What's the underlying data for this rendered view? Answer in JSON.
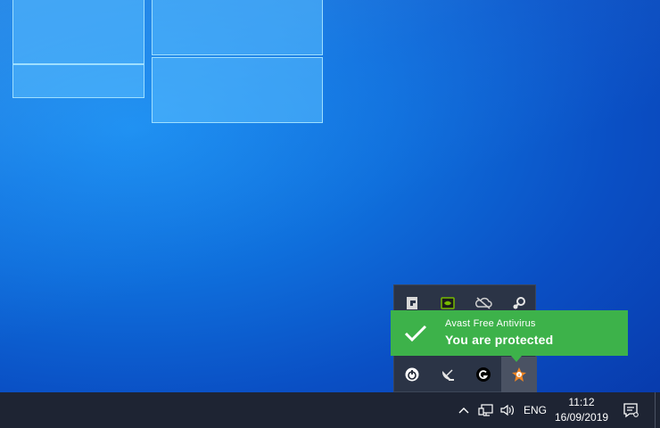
{
  "toast": {
    "app_name": "Avast Free Antivirus",
    "message": "You are protected",
    "accent": "#3db24a"
  },
  "tray_overflow": {
    "icons": [
      "gigabyte-app-icon",
      "nvidia-icon",
      "onedrive-offline-icon",
      "steam-icon",
      "power-app-icon",
      "satellite-dish-icon",
      "logitech-g-icon",
      "avast-icon"
    ]
  },
  "taskbar": {
    "show_hidden_icons": "chevron-up-icon",
    "language": "ENG",
    "clock_time": "11:12",
    "clock_date": "16/09/2019",
    "background": "#1e2433"
  }
}
